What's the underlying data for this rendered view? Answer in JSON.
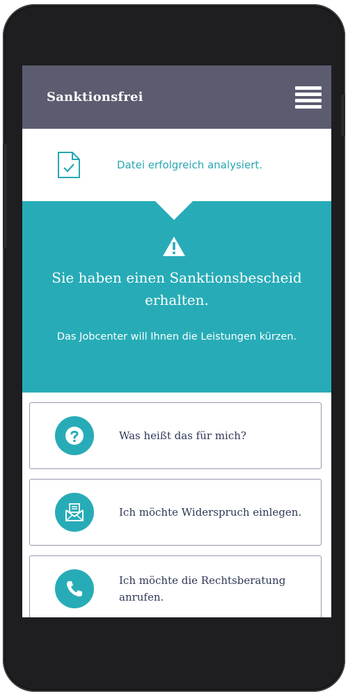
{
  "header": {
    "title": "Sanktionsfrei"
  },
  "status": {
    "message": "Datei erfolgreich analysiert."
  },
  "hero": {
    "title": "Sie haben einen Sanktionsbescheid erhalten.",
    "subtitle": "Das Jobcenter will Ihnen die Leistungen kürzen."
  },
  "actions": [
    {
      "label": "Was heißt das für mich?",
      "icon": "question-icon"
    },
    {
      "label": "Ich möchte Widerspruch einlegen.",
      "icon": "letter-icon"
    },
    {
      "label": "Ich möchte die Rechtsberatung anrufen.",
      "icon": "phone-icon"
    }
  ],
  "colors": {
    "header": "#5b5c70",
    "accent": "#27acb7",
    "card_border": "#9598ab",
    "text_dark": "#2e3856"
  }
}
